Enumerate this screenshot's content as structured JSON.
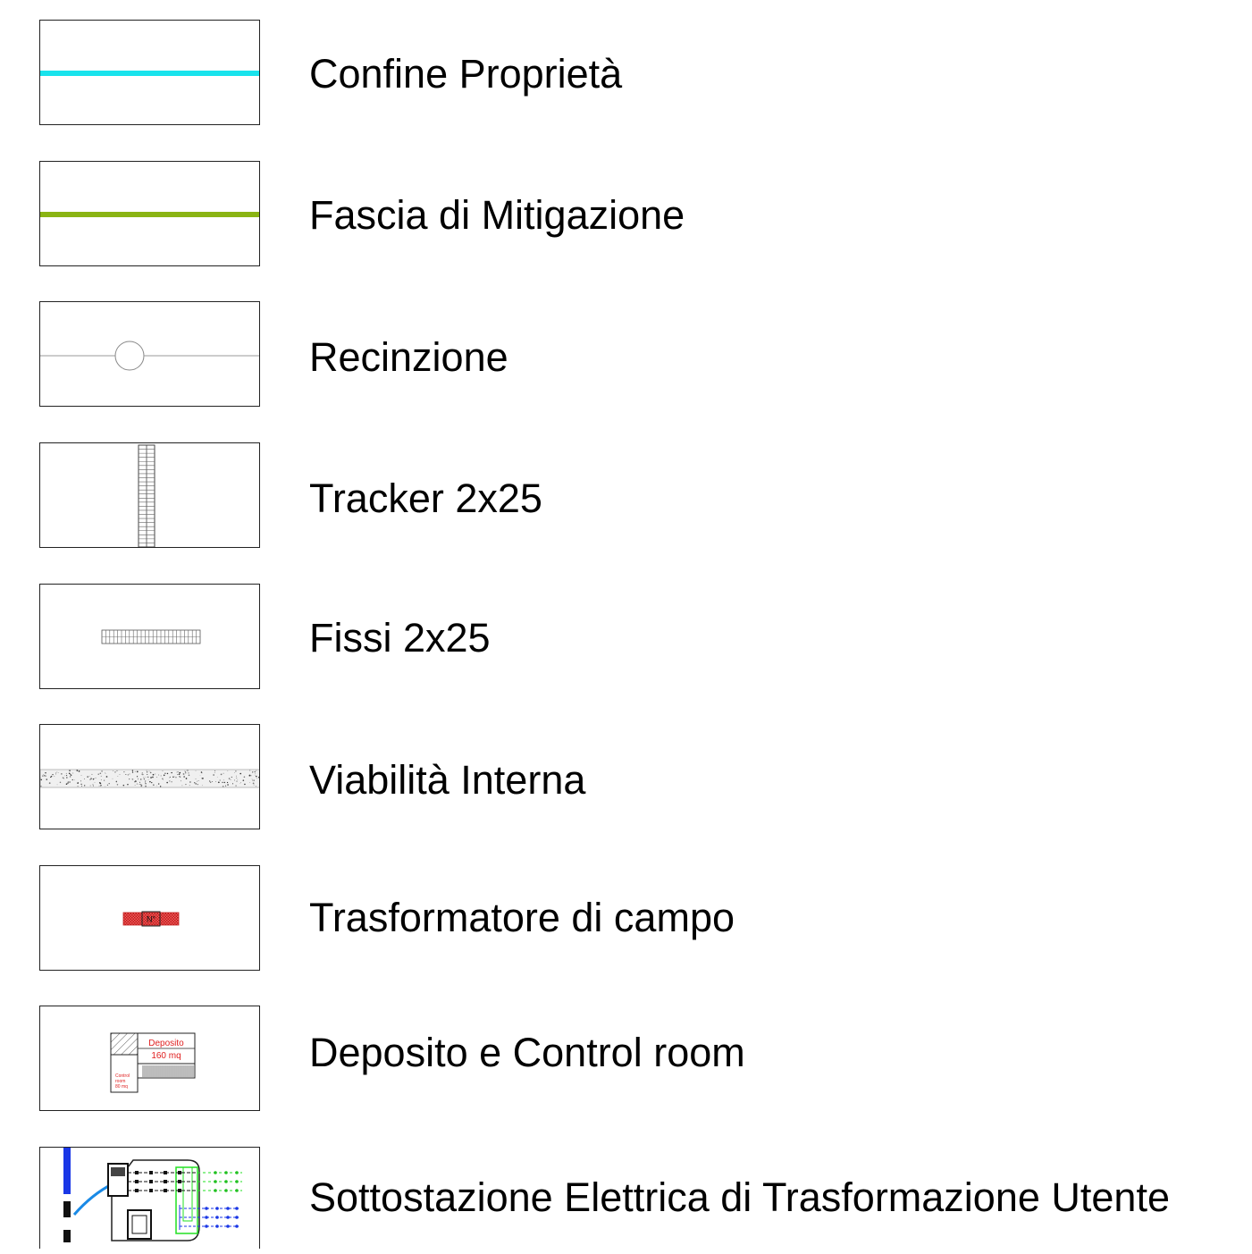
{
  "legend": {
    "items": [
      {
        "id": "confine",
        "label": "Confine Proprietà",
        "color": "#19e3ec"
      },
      {
        "id": "mitigazione",
        "label": "Fascia di Mitigazione",
        "color": "#8ab413"
      },
      {
        "id": "recinzione",
        "label": "Recinzione",
        "color": "#aaaaaa"
      },
      {
        "id": "tracker",
        "label": "Tracker 2x25",
        "color": "#555555"
      },
      {
        "id": "fissi",
        "label": "Fissi 2x25",
        "color": "#777777"
      },
      {
        "id": "viabilita",
        "label": "Viabilità Interna",
        "color": "#dddddd"
      },
      {
        "id": "trasformatore",
        "label": "Trasformatore di campo",
        "color": "#e53333",
        "symbol_text": "N°"
      },
      {
        "id": "deposito",
        "label": "Deposito e Control room",
        "color": "#e02020",
        "symbol_text_1": "Deposito",
        "symbol_text_2": "160 mq",
        "symbol_text_3": "Control",
        "symbol_text_4": "room",
        "symbol_text_5": "80 mq"
      },
      {
        "id": "sottostazione",
        "label": "Sottostazione Elettrica di Trasformazione Utente",
        "color": "#1a37e6",
        "accent_color": "#22e022"
      }
    ]
  }
}
